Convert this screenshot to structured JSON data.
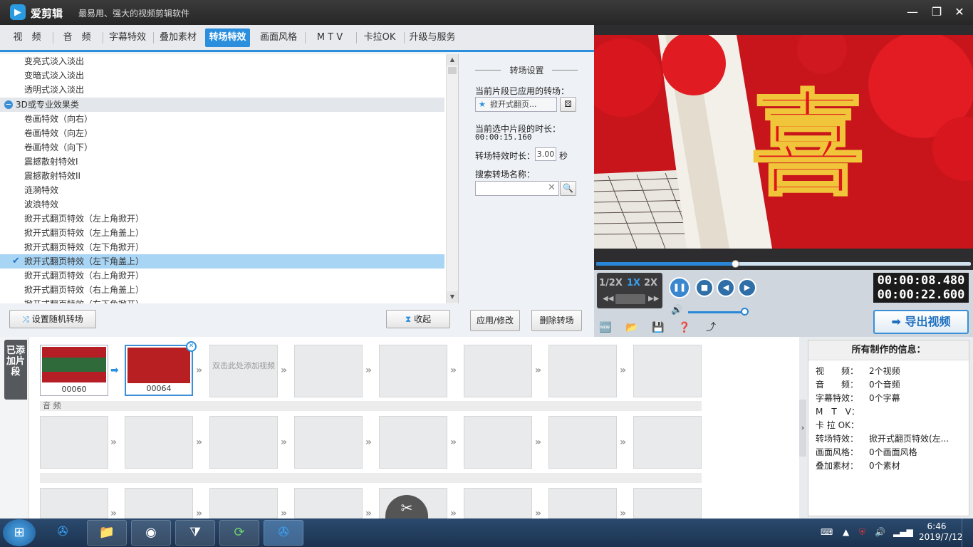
{
  "titlebar": {
    "app_name": "爱剪辑",
    "slogan": "最易用、强大的视频剪辑软件"
  },
  "tabs": [
    "视　频",
    "音　频",
    "字幕特效",
    "叠加素材",
    "转场特效",
    "画面风格",
    "M T V",
    "卡拉OK",
    "升级与服务"
  ],
  "transition_list": {
    "items": [
      "变亮式淡入淡出",
      "变暗式淡入淡出",
      "透明式淡入淡出",
      "3D或专业效果类",
      "卷画特效（向右）",
      "卷画特效（向左）",
      "卷画特效（向下）",
      "震撼散射特效I",
      "震撼散射特效II",
      "涟漪特效",
      "波浪特效",
      "掀开式翻页特效（左上角掀开）",
      "掀开式翻页特效（左上角盖上）",
      "掀开式翻页特效（左下角掀开）",
      "掀开式翻页特效（左下角盖上）",
      "掀开式翻页特效（右上角掀开）",
      "掀开式翻页特效（右上角盖上）",
      "掀开式翻页特效（右下角掀开）"
    ],
    "random_button": "设置随机转场",
    "collapse_button": "收起"
  },
  "settings": {
    "title": "转场设置",
    "applied_label": "当前片段已应用的转场：",
    "applied_value": "掀开式翻页...",
    "duration_label": "当前选中片段的时长：",
    "duration_value": "00:00:15.160",
    "effect_duration_label": "转场特效时长：",
    "effect_duration_value": "3.00",
    "seconds_unit": "秒",
    "search_label": "搜索转场名称：",
    "search_value": "",
    "apply_button": "应用/修改",
    "delete_button": "删除转场"
  },
  "player": {
    "progress": 0.37,
    "speeds": [
      "1/2X",
      "1X",
      "2X"
    ],
    "current_time": "00:00:08.480",
    "total_time": "00:00:22.600",
    "volume": 0.9,
    "export_button": "导出视频",
    "colors": {
      "accent": "#2b8fdd",
      "video_red": "#c4141a"
    }
  },
  "timeline": {
    "side_tab": "已添加片段",
    "clips": [
      {
        "label": "00060"
      },
      {
        "label": "00064"
      }
    ],
    "placeholder": "双击此处添加视频",
    "audio_label": "音 频"
  },
  "info": {
    "title": "所有制作的信息：",
    "rows": [
      {
        "k": "视　　频：",
        "v": "2个视频"
      },
      {
        "k": "音　　频：",
        "v": "0个音频"
      },
      {
        "k": "字幕特效：",
        "v": "0个字幕"
      },
      {
        "k": "M　T　V：",
        "v": ""
      },
      {
        "k": "卡 拉 OK：",
        "v": ""
      },
      {
        "k": "转场特效：",
        "v": "掀开式翻页特效(左..."
      },
      {
        "k": "画面风格：",
        "v": "0个画面风格"
      },
      {
        "k": "叠加素材：",
        "v": "0个素材"
      }
    ]
  },
  "taskbar": {
    "time": "6:46",
    "date": "2019/7/12"
  }
}
